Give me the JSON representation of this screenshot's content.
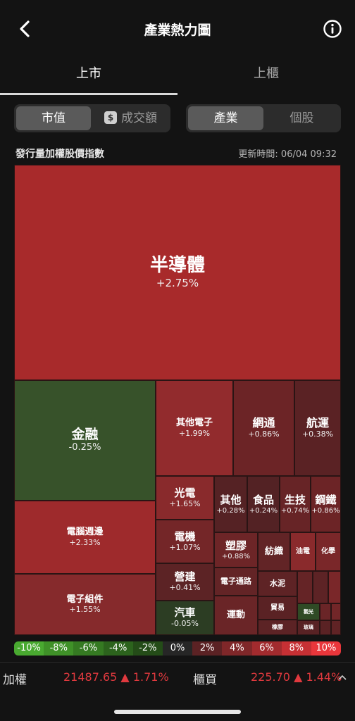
{
  "header": {
    "title": "產業熱力圖"
  },
  "market_tabs": [
    {
      "label": "上市",
      "active": true
    },
    {
      "label": "上櫃",
      "active": false
    }
  ],
  "measure_toggle": {
    "options": [
      "市值",
      "成交額"
    ],
    "selected": 0,
    "coin_symbol": "$"
  },
  "view_toggle": {
    "options": [
      "產業",
      "個股"
    ],
    "selected": 0
  },
  "index_title": "發行量加權股價指數",
  "update_time": "更新時間: 06/04 09:32",
  "cells": [
    {
      "name": "半導體",
      "pct": "+2.75%",
      "color": "#a82a2b"
    },
    {
      "name": "金融",
      "pct": "-0.25%",
      "color": "#37522a"
    },
    {
      "name": "其他電子",
      "pct": "+1.99%",
      "color": "#922b2d"
    },
    {
      "name": "網通",
      "pct": "+0.86%",
      "color": "#6c2426"
    },
    {
      "name": "航運",
      "pct": "+0.38%",
      "color": "#5a2224"
    },
    {
      "name": "電腦週邊",
      "pct": "+2.33%",
      "color": "#9e2a2c"
    },
    {
      "name": "電子組件",
      "pct": "+1.55%",
      "color": "#862a2c"
    },
    {
      "name": "光電",
      "pct": "+1.65%",
      "color": "#892a2c"
    },
    {
      "name": "電機",
      "pct": "+1.07%",
      "color": "#742628"
    },
    {
      "name": "營建",
      "pct": "+0.41%",
      "color": "#5c2325"
    },
    {
      "name": "汽車",
      "pct": "-0.05%",
      "color": "#2c3d23"
    },
    {
      "name": "其他",
      "pct": "+0.28%",
      "color": "#552224"
    },
    {
      "name": "食品",
      "pct": "+0.24%",
      "color": "#532224"
    },
    {
      "name": "生技",
      "pct": "+0.74%",
      "color": "#672426"
    },
    {
      "name": "鋼鐵",
      "pct": "+0.86%",
      "color": "#6c2426"
    },
    {
      "name": "塑膠",
      "pct": "+0.88%",
      "color": "#6d2527"
    },
    {
      "name": "紡織",
      "pct": "",
      "color": "#622426"
    },
    {
      "name": "油電",
      "pct": "",
      "color": "#8a2a2c"
    },
    {
      "name": "化學",
      "pct": "",
      "color": "#7a2729"
    },
    {
      "name": "電子通路",
      "pct": "",
      "color": "#632426"
    },
    {
      "name": "水泥",
      "pct": "",
      "color": "#5e2325"
    },
    {
      "name": "運動",
      "pct": "",
      "color": "#6a2527"
    },
    {
      "name": "貿易",
      "pct": "",
      "color": "#5a2224"
    },
    {
      "name": "橡膠",
      "pct": "",
      "color": "#5c2325"
    },
    {
      "name": "",
      "pct": "",
      "color": "#652426"
    },
    {
      "name": "",
      "pct": "",
      "color": "#5d2325"
    },
    {
      "name": "",
      "pct": "",
      "color": "#7a2729"
    },
    {
      "name": "觀光",
      "pct": "",
      "color": "#2f4a25"
    },
    {
      "name": "",
      "pct": "",
      "color": "#6a2527"
    },
    {
      "name": "",
      "pct": "",
      "color": "#722628"
    },
    {
      "name": "玻璃",
      "pct": "",
      "color": "#582224"
    },
    {
      "name": "",
      "pct": "",
      "color": "#5a2224"
    },
    {
      "name": "",
      "pct": "",
      "color": "#602325"
    }
  ],
  "legend": [
    {
      "label": "-10%",
      "color": "#49a930"
    },
    {
      "label": "-8%",
      "color": "#3f9128"
    },
    {
      "label": "-6%",
      "color": "#357a22"
    },
    {
      "label": "-4%",
      "color": "#2c631d"
    },
    {
      "label": "-2%",
      "color": "#244c18"
    },
    {
      "label": "0%",
      "color": "#262626"
    },
    {
      "label": "2%",
      "color": "#5b2224"
    },
    {
      "label": "4%",
      "color": "#7f2729"
    },
    {
      "label": "6%",
      "color": "#a22b2e"
    },
    {
      "label": "8%",
      "color": "#c63034"
    },
    {
      "label": "10%",
      "color": "#e9363b"
    }
  ],
  "bottom": {
    "taiex_label": "加權",
    "taiex_value": "21487.65 ▲ 1.71%",
    "otc_label": "櫃買",
    "otc_value": "225.70 ▲ 1.44%",
    "up_color": "#e0393e"
  }
}
